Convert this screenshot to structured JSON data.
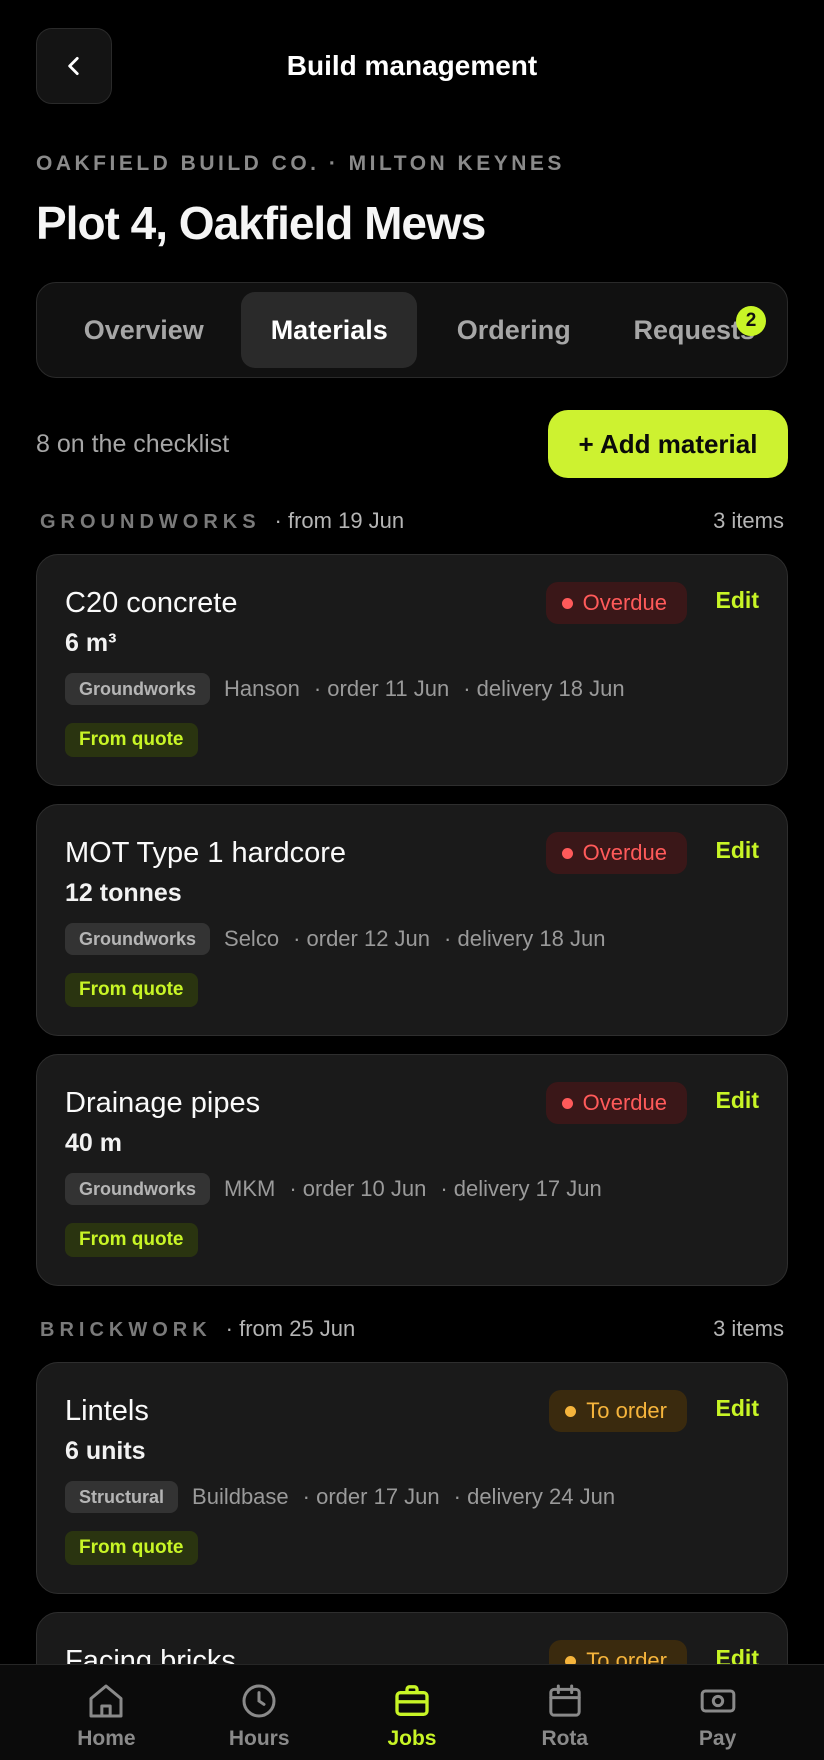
{
  "header": {
    "title": "Build management"
  },
  "company": "OAKFIELD BUILD CO. · MILTON KEYNES",
  "plot_title": "Plot 4, Oakfield Mews",
  "tabs": [
    {
      "label": "Overview"
    },
    {
      "label": "Materials"
    },
    {
      "label": "Ordering"
    },
    {
      "label": "Requests",
      "badge": "2"
    }
  ],
  "checklist_count": "8 on the checklist",
  "add_button": "+ Add material",
  "sections": [
    {
      "name": "GROUNDWORKS",
      "from": "· from 19 Jun",
      "count": "3 items"
    },
    {
      "name": "BRICKWORK",
      "from": "· from 25 Jun",
      "count": "3 items"
    }
  ],
  "materials": [
    {
      "name": "C20 concrete",
      "qty": "6 m³",
      "status": "Overdue",
      "edit": "Edit",
      "trade": "Groundworks",
      "supplier": "Hanson",
      "order": "· order 11 Jun",
      "delivery": "· delivery 18 Jun",
      "tag": "From quote"
    },
    {
      "name": "MOT Type 1 hardcore",
      "qty": "12 tonnes",
      "status": "Overdue",
      "edit": "Edit",
      "trade": "Groundworks",
      "supplier": "Selco",
      "order": "· order 12 Jun",
      "delivery": "· delivery 18 Jun",
      "tag": "From quote"
    },
    {
      "name": "Drainage pipes",
      "qty": "40 m",
      "status": "Overdue",
      "edit": "Edit",
      "trade": "Groundworks",
      "supplier": "MKM",
      "order": "· order 10 Jun",
      "delivery": "· delivery 17 Jun",
      "tag": "From quote"
    },
    {
      "name": "Lintels",
      "qty": "6 units",
      "status": "To order",
      "edit": "Edit",
      "trade": "Structural",
      "supplier": "Buildbase",
      "order": "· order 17 Jun",
      "delivery": "· delivery 24 Jun",
      "tag": "From quote"
    },
    {
      "name": "Facing bricks",
      "status": "To order",
      "edit": "Edit"
    }
  ],
  "nav": [
    {
      "label": "Home"
    },
    {
      "label": "Hours"
    },
    {
      "label": "Jobs"
    },
    {
      "label": "Rota"
    },
    {
      "label": "Pay"
    }
  ],
  "colors": {
    "accent": "#c8f526",
    "overdue": "#ff5a5a",
    "to_order": "#f5b43c",
    "background": "#000000",
    "card": "#1a1a1a"
  }
}
